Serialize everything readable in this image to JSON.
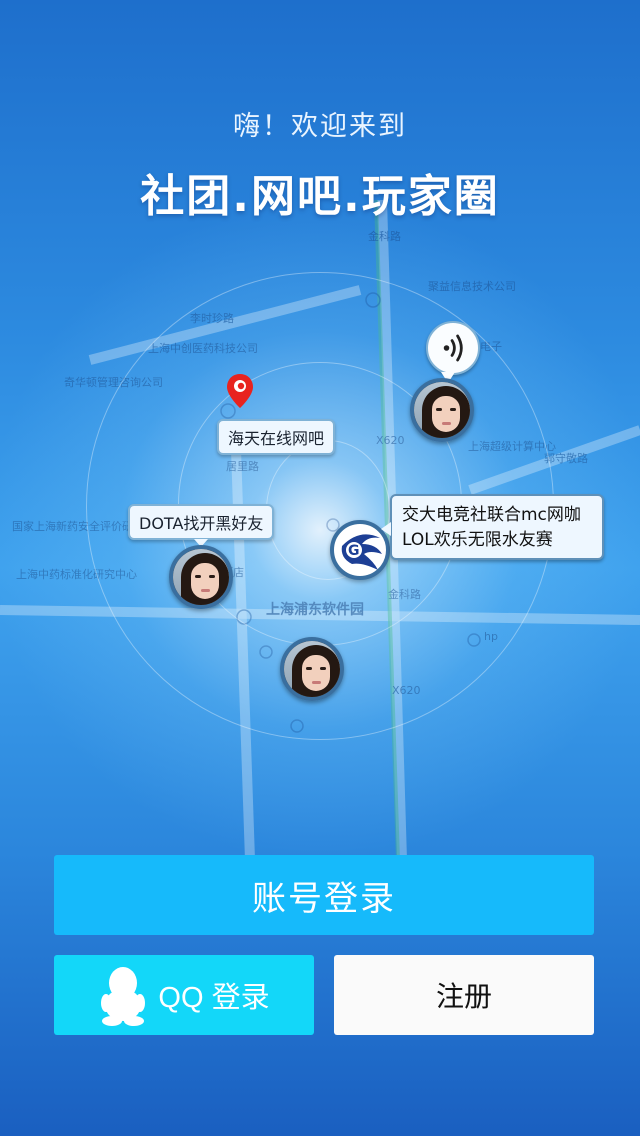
{
  "header": {
    "welcome": "嗨！欢迎来到",
    "headline": "社团.网吧.玩家圈"
  },
  "map": {
    "labels": {
      "jinke_road": "金科路",
      "lishizhen_road": "李时珍路",
      "juyi": "聚益信息技术公司",
      "chuangxin": "上海中创医药科技公司",
      "qihua": "奇华顿管理咨询公司",
      "guojia": "国家上海新药安全评价研究中心",
      "zhongyao": "上海中药标准化研究中心",
      "juli_road": "居里路",
      "pudong_park": "上海浦东软件园",
      "chaoji": "上海超级计算中心",
      "guoshou_road": "郭守敬路",
      "road_x620": "X620",
      "hp": "hp",
      "dianzi": "电子",
      "jiudian": "酒店"
    }
  },
  "places": {
    "net_cafe": "海天在线网吧"
  },
  "users": {
    "dota_user_status": "DOTA找开黑好友"
  },
  "events": {
    "lol_event": "交大电竞社联合mc网咖\nLOL欢乐无限水友赛"
  },
  "actions": {
    "account_login": "账号登录",
    "qq_login": "QQ 登录",
    "register": "注册"
  },
  "icons": {
    "pin": "location-pin-icon",
    "sound": "sound-wave-icon",
    "logo": "g-club-logo-icon",
    "qq": "qq-penguin-icon"
  },
  "colors": {
    "account_button": "#16bafb",
    "qq_button": "#13d7f9",
    "register_button": "#fafafa",
    "pin": "#e8231f"
  }
}
